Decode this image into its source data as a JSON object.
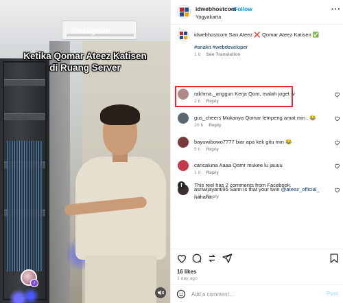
{
  "video": {
    "caption_line1": "Ketika Qomar Ateez Katisen",
    "caption_line2": "di Ruang Server",
    "watermark": "Instagram"
  },
  "header": {
    "username": "idwebhostcom",
    "dot": "•",
    "follow_label": "Follow",
    "location": "Yogyakarta",
    "more": "···"
  },
  "caption": {
    "username": "idwebhostcom",
    "text": "San Ateez ❌ Qomar Ateez Katisen ✅",
    "hashtags": "#anakit #webdeveloper",
    "time": "1 d",
    "see_translation": "See Translation"
  },
  "comments": [
    {
      "username": "rakhma._anggun",
      "text": "Kerja Qom, malah joget :v",
      "time": "2 h",
      "reply": "Reply",
      "avatar_color": "#b08a86"
    },
    {
      "username": "gus_cheers",
      "text": "Mukanya Qomar lempeng amat min.. 😂",
      "time": "20 h",
      "reply": "Reply",
      "avatar_color": "#5b6770"
    },
    {
      "username": "bayuwibowo7777",
      "text": "biar apa kek gitu min 😂",
      "time": "5 h",
      "reply": "Reply",
      "avatar_color": "#7a3b3b"
    },
    {
      "username": "caricaluna",
      "text": "Aaaa Qomr mukee lu jauuu",
      "time": "1 d",
      "reply": "Reply",
      "avatar_color": "#c33a4a"
    },
    {
      "username": "asriwijayanti95",
      "text": "Sann is that your twin",
      "mention": "@ateez_official_",
      "text_after": "hahaha",
      "time": "6 h",
      "reply": "Reply",
      "avatar_color": "#3b2f2f"
    }
  ],
  "facebook_note": "This reel has 2 comments from Facebook.",
  "likes": "16 likes",
  "post_time": "1 day ago",
  "add_comment": {
    "placeholder": "Add a comment…",
    "post_label": "Post"
  },
  "colors": {
    "follow": "#0095f6",
    "highlight": "#e12b2b",
    "muted": "#8e8e8e"
  }
}
